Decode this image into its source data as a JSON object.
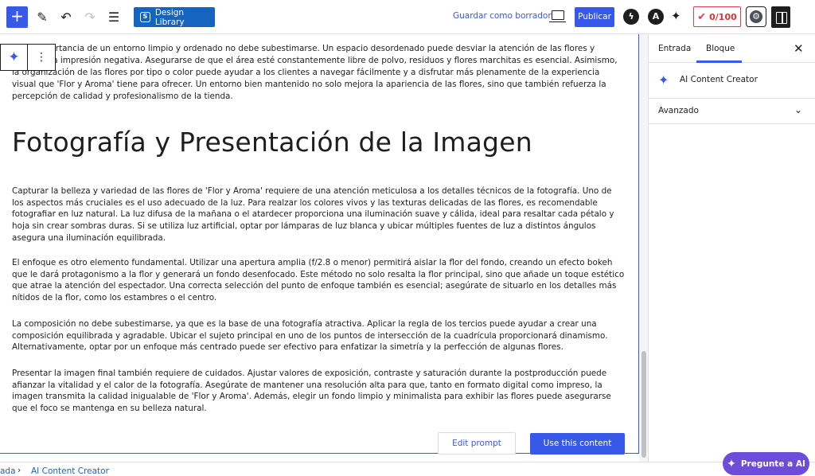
{
  "toolbar": {
    "add_icon": "+",
    "pen_icon": "✎",
    "undo_icon": "↶",
    "redo_icon": "↷",
    "list_icon": "☰",
    "design_library_badge": "S",
    "design_library_label": "Design Library",
    "save_draft_label": "Guardar como borrador",
    "publish_label": "Publicar",
    "seo_score": "0/100",
    "colors": {
      "accent": "#3858e9",
      "design_library": "#1565c0",
      "score": "#d63638"
    }
  },
  "canvas": {
    "top_paragraph": "de la importancia de un entorno limpio y ordenado no debe subestimarse. Un espacio desordenado puede desviar la atención de las flores y causar una impresión negativa. Asegurarse de que el área esté constantemente libre de polvo, residuos y flores marchitas es esencial. Asimismo, la organización de las flores por tipo o color puede ayudar a los clientes a navegar fácilmente y a disfrutar más plenamente de la experiencia visual que 'Flor y Aroma' tiene para ofrecer. Un entorno bien mantenido no solo mejora la apariencia de las flores, sino que también refuerza la percepción de calidad y profesionalismo de la tienda.",
    "heading": "Fotografía y Presentación de la Imagen",
    "paragraphs": [
      "Capturar la belleza y variedad de las flores de 'Flor y Aroma' requiere de una atención meticulosa a los detalles técnicos de la fotografía. Uno de los aspectos más cruciales es el uso adecuado de la luz. Para realzar los colores vivos y las texturas delicadas de las flores, es recomendable fotografiar en luz natural. La luz difusa de la mañana o el atardecer proporciona una iluminación suave y cálida, ideal para resaltar cada pétalo y hoja sin crear sombras duras. Si se utiliza luz artificial, optar por lámparas de luz blanca y ubicar múltiples fuentes de luz a distintos ángulos asegura una iluminación equilibrada.",
      "El enfoque es otro elemento fundamental. Utilizar una apertura amplia (f/2.8 o menor) permitirá aislar la flor del fondo, creando un efecto bokeh que le dará protagonismo a la flor y generará un fondo desenfocado. Este método no solo resalta la flor principal, sino que añade un toque estético que atrae la atención del espectador. Una correcta selección del punto de enfoque también es esencial; asegúrate de situarlo en los detalles más nítidos de la flor, como los estambres o el centro.",
      "La composición no debe subestimarse, ya que es la base de una fotografía atractiva. Aplicar la regla de los tercios puede ayudar a crear una composición equilibrada y agradable. Ubicar el sujeto principal en uno de los puntos de intersección de la cuadrícula proporcionará dinamismo. Alternativamente, optar por un enfoque más centrado puede ser efectivo para enfatizar la simetría y la perfección de algunas flores.",
      "Presentar la imagen final también requiere de cuidados. Ajustar valores de exposición, contraste y saturación durante la postproducción puede afianzar la vitalidad y el calor de la fotografía. Asegúrate de mantener una resolución alta para que, tanto en formato digital como impreso, la imagen transmita la calidad inigualable de 'Flor y Aroma'. Además, elegir un fondo limpio y minimalista para exhibir las flores puede asegurarse que el foco se mantenga en su belleza natural."
    ],
    "edit_prompt_label": "Edit prompt",
    "use_content_label": "Use this content"
  },
  "breadcrumb": {
    "items": [
      "ada",
      "AI Content Creator"
    ],
    "separator": "›"
  },
  "sidebar": {
    "tabs": [
      "Entrada",
      "Bloque"
    ],
    "active_tab": "Bloque",
    "close_icon": "✕",
    "block_name": "AI Content Creator",
    "advanced_label": "Avanzado",
    "chevron_icon": "⌄"
  },
  "ask_ai": {
    "label": "Pregunte a AI",
    "color": "#6c4cd9"
  }
}
